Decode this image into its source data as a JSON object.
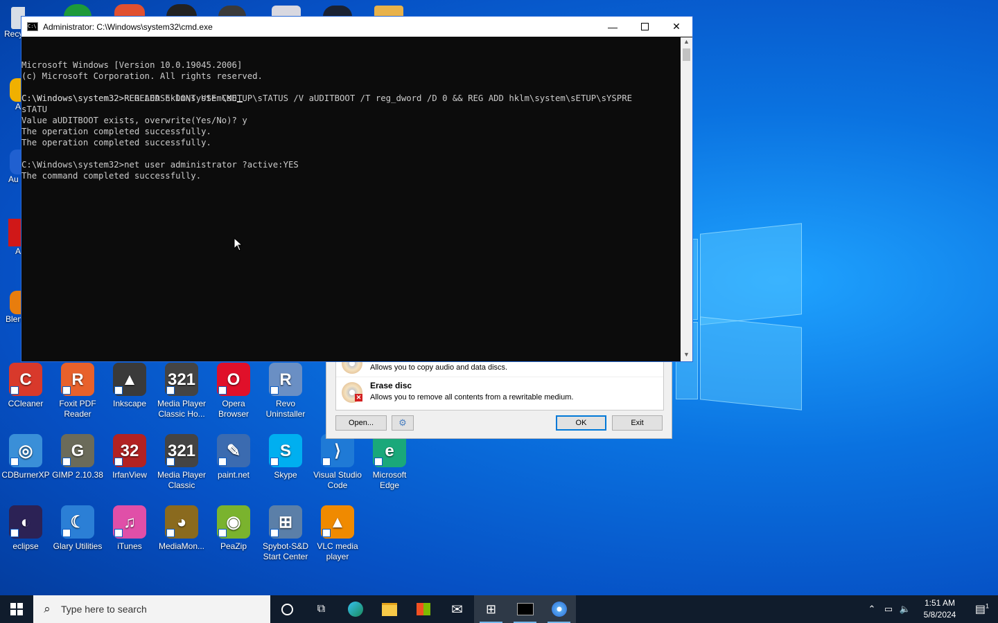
{
  "cmd": {
    "title": "Administrator: C:\\Windows\\system32\\cmd.exe",
    "icon_text": "C:\\",
    "lines": [
      "Microsoft Windows [Version 10.0.19045.2006]",
      "(c) Microsoft Corporation. All rights reserved.",
      "",
      "C:\\Windows\\system32>REG ADD hklm\\system\\sETUP\\sTATUS /V aUDITBOOT /T reg_dword /D 0 && REG ADD hklm\\system\\sETUP\\sYSPRE",
      "sTATU",
      "Value aUDITBOOT exists, overwrite(Yes/No)? y",
      "The operation completed successfully.",
      "The operation completed successfully.",
      "",
      "C:\\Windows\\system32>net user administrator ?active:YES",
      "The command completed successfully.",
      "",
      ""
    ],
    "prompt_line": "C:\\Windows\\system32>RERELEASE DONT USE CMD"
  },
  "dialog": {
    "copy_desc": "Allows you to copy audio and data discs.",
    "erase_title": "Erase disc",
    "erase_desc": "Allows you to remove all contents from a rewritable medium.",
    "open_label": "Open...",
    "ok_label": "OK",
    "exit_label": "Exit"
  },
  "desktop": {
    "partial_left": [
      {
        "label": "Recy"
      },
      {
        "label": "A"
      },
      {
        "label": "Au"
      },
      {
        "label": "A"
      },
      {
        "label": "Blen"
      }
    ],
    "row1": [
      {
        "label": "CCleaner",
        "glyph": "C",
        "color": "#d8392b"
      },
      {
        "label": "Foxit PDF Reader",
        "glyph": "R",
        "color": "#e8612b"
      },
      {
        "label": "Inkscape",
        "glyph": "▲",
        "color": "#3a3a3a"
      },
      {
        "label": "Media Player Classic Ho...",
        "glyph": "321",
        "color": "#444444"
      },
      {
        "label": "Opera Browser",
        "glyph": "O",
        "color": "#e0102a"
      },
      {
        "label": "Revo Uninstaller",
        "glyph": "R",
        "color": "#6a8fc4"
      }
    ],
    "row2": [
      {
        "label": "CDBurnerXP",
        "glyph": "◎",
        "color": "#3a8fd8"
      },
      {
        "label": "GIMP 2.10.38",
        "glyph": "G",
        "color": "#6b6b5a"
      },
      {
        "label": "IrfanView",
        "glyph": "32",
        "color": "#b22222"
      },
      {
        "label": "Media Player Classic",
        "glyph": "321",
        "color": "#444444"
      },
      {
        "label": "paint.net",
        "glyph": "✎",
        "color": "#3b6bb0"
      },
      {
        "label": "Skype",
        "glyph": "S",
        "color": "#00aff0"
      },
      {
        "label": "Visual Studio Code",
        "glyph": "⟩",
        "color": "#1f7ad6"
      },
      {
        "label": "Microsoft Edge",
        "glyph": "e",
        "color": "#1aa87a"
      }
    ],
    "row3": [
      {
        "label": "eclipse",
        "glyph": "◐",
        "color": "#2c2255"
      },
      {
        "label": "Glary Utilities",
        "glyph": "☾",
        "color": "#2b7fd6"
      },
      {
        "label": "iTunes",
        "glyph": "♫",
        "color": "#e04fa8"
      },
      {
        "label": "MediaMon...",
        "glyph": "◕",
        "color": "#8a6a1e"
      },
      {
        "label": "PeaZip",
        "glyph": "◉",
        "color": "#7ab32e"
      },
      {
        "label": "Spybot-S&D Start Center",
        "glyph": "⊞",
        "color": "#5b7fa8"
      },
      {
        "label": "VLC media player",
        "glyph": "▲",
        "color": "#f08a00"
      }
    ]
  },
  "taskbar": {
    "search_placeholder": "Type here to search",
    "time": "1:51 AM",
    "date": "5/8/2024",
    "notif_count": "1"
  }
}
